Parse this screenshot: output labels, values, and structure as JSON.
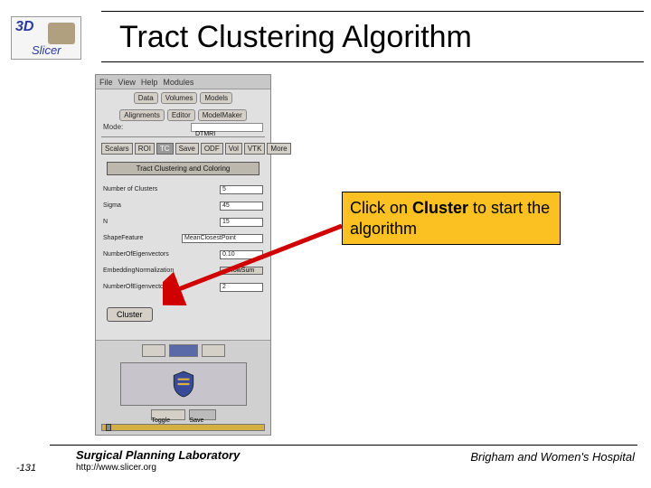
{
  "header": {
    "logo_3d": "3D",
    "logo_slicer": "Slicer",
    "title": "Tract Clustering Algorithm"
  },
  "ui": {
    "menu": {
      "file": "File",
      "view": "View",
      "help": "Help",
      "modules": "Modules"
    },
    "row1": {
      "data": "Data",
      "volumes": "Volumes",
      "models": "Models"
    },
    "row2": {
      "alignments": "Alignments",
      "editor": "Editor",
      "modelmaker": "ModelMaker"
    },
    "mode_label": "Mode:",
    "mode_value": "DTMRI",
    "tabs": {
      "scalars": "Scalars",
      "roi": "ROI",
      "tc": "TC",
      "save": "Save",
      "odf": "ODF",
      "vol": "Vol",
      "vtk": "VTK",
      "more": "More"
    },
    "bigbutton": "Tract Clustering and Coloring",
    "form": {
      "clusters_label": "Number of Clusters",
      "clusters_val": "5",
      "sigma_label": "Sigma",
      "sigma_val": "45",
      "n_label": "N",
      "n_val": "15",
      "shape_label": "ShapeFeature",
      "shape_val": "MeanClosestPoint",
      "eig_label": "NumberOfEigenvectors",
      "eig_val": "0.10",
      "norm_label": "EmbeddingNormalization",
      "norm_btn": "RowSum",
      "eigsys_label": "NumberOfEigenvectors",
      "eigsys_val": "2"
    },
    "cluster_btn": "Cluster",
    "credits": {
      "toggle": "Toggle",
      "save": "Save"
    }
  },
  "callout": {
    "pre": "Click on ",
    "bold": "Cluster",
    "post": " to start the algorithm"
  },
  "footer": {
    "left": "Surgical Planning Laboratory",
    "url": "http://www.slicer.org",
    "page": "-131",
    "right": "Brigham and Women's Hospital"
  }
}
